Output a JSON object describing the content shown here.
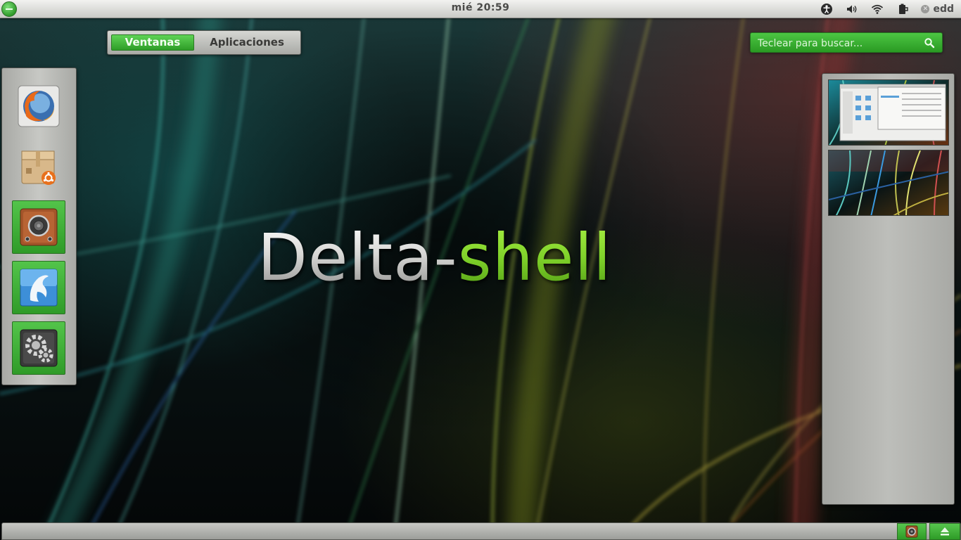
{
  "topbar": {
    "activities_icon": "activities-icon",
    "clock": "mié 20:59",
    "tray_icons": [
      "accessibility-icon",
      "volume-icon",
      "wifi-icon",
      "battery-icon"
    ],
    "user_name": "edd"
  },
  "view_switcher": {
    "windows_label": "Ventanas",
    "apps_label": "Aplicaciones",
    "active": "Ventanas"
  },
  "search": {
    "placeholder": "Teclear para buscar..."
  },
  "dash": {
    "items": [
      {
        "icon": "firefox-icon",
        "running": false
      },
      {
        "icon": "software-center-icon",
        "running": false
      },
      {
        "icon": "speaker-icon",
        "running": true
      },
      {
        "icon": "dolphin-icon",
        "running": true
      },
      {
        "icon": "system-settings-icon",
        "running": true
      }
    ]
  },
  "logo": {
    "part1": "Delta-",
    "part2": "shell"
  },
  "workspaces": {
    "thumbnails": [
      "workspace-1",
      "workspace-2"
    ]
  },
  "bottombar": {
    "tray_items": [
      "speaker-icon",
      "eject-icon"
    ]
  },
  "colors": {
    "accent_green": "#2e9b27",
    "panel_gray": "#c7c8c4",
    "logo_green": "#7fd12a"
  }
}
